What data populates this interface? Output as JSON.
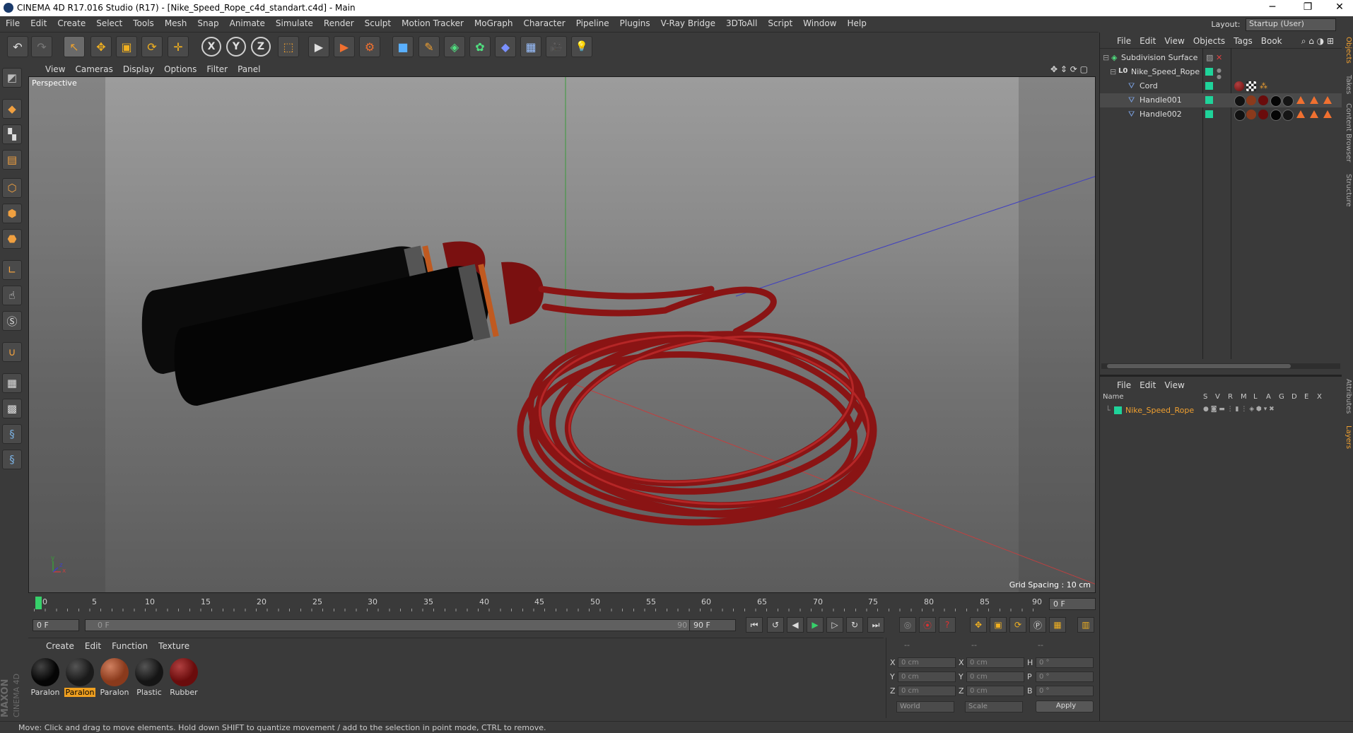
{
  "window": {
    "title": "CINEMA 4D R17.016 Studio (R17) - [Nike_Speed_Rope_c4d_standart.c4d] - Main",
    "minimize": "─",
    "restore": "❐",
    "close": "✕"
  },
  "menu": [
    "File",
    "Edit",
    "Create",
    "Select",
    "Tools",
    "Mesh",
    "Snap",
    "Animate",
    "Simulate",
    "Render",
    "Sculpt",
    "Motion Tracker",
    "MoGraph",
    "Character",
    "Pipeline",
    "Plugins",
    "V-Ray Bridge",
    "3DToAll",
    "Script",
    "Window",
    "Help"
  ],
  "layout": {
    "label": "Layout:",
    "value": "Startup (User)"
  },
  "toolbar": {
    "undo": "↶",
    "redo": "↷",
    "select": "↖",
    "move": "✥",
    "scale": "▣",
    "rotate": "⟳",
    "live": "✛",
    "x": "X",
    "y": "Y",
    "z": "Z",
    "coord": "⬚",
    "render_view": "▶",
    "render_pic": "▶",
    "render_settings": "⚙",
    "cube": "■",
    "pen": "✎",
    "subdiv": "◈",
    "array": "✿",
    "deform": "◆",
    "floor": "▦",
    "camera": "🎥",
    "light": "💡"
  },
  "viewport": {
    "menu": [
      "View",
      "Cameras",
      "Display",
      "Options",
      "Filter",
      "Panel"
    ],
    "label": "Perspective",
    "grid_spacing": "Grid Spacing : 10 cm",
    "axis_y": "y",
    "axis_x": "x",
    "axis_z": "z"
  },
  "timeline": {
    "ticks": [
      "0",
      "5",
      "10",
      "15",
      "20",
      "25",
      "30",
      "35",
      "40",
      "45",
      "50",
      "55",
      "60",
      "65",
      "70",
      "75",
      "80",
      "85",
      "90"
    ],
    "current_frame": "0 F",
    "start_frame": "0 F",
    "range_start": "0 F",
    "range_end": "90 F",
    "end_frame": "90 F"
  },
  "materials": {
    "menu": [
      "Create",
      "Edit",
      "Function",
      "Texture"
    ],
    "items": [
      {
        "name": "Paralon",
        "color": "#050505",
        "selected": false
      },
      {
        "name": "Paralon",
        "color": "#1a1a1a",
        "selected": true
      },
      {
        "name": "Paralon",
        "color": "#8a3a1c",
        "selected": false
      },
      {
        "name": "Plastic",
        "color": "#151515",
        "selected": false
      },
      {
        "name": "Rubber",
        "color": "#6a0c0c",
        "selected": false
      }
    ]
  },
  "coords": {
    "header": [
      "--",
      "--",
      "--"
    ],
    "rows": [
      {
        "a": "X",
        "av": "0 cm",
        "b": "X",
        "bv": "0 cm",
        "c": "H",
        "cv": "0 °"
      },
      {
        "a": "Y",
        "av": "0 cm",
        "b": "Y",
        "bv": "0 cm",
        "c": "P",
        "cv": "0 °"
      },
      {
        "a": "Z",
        "av": "0 cm",
        "b": "Z",
        "bv": "0 cm",
        "c": "B",
        "cv": "0 °"
      }
    ],
    "world": "World",
    "scale": "Scale",
    "apply": "Apply"
  },
  "objects": {
    "menu": [
      "File",
      "Edit",
      "View",
      "Objects",
      "Tags",
      "Book"
    ],
    "items": [
      {
        "name": "Subdivision Surface",
        "indent": 0
      },
      {
        "name": "Nike_Speed_Rope",
        "indent": 1
      },
      {
        "name": "Cord",
        "indent": 2
      },
      {
        "name": "Handle001",
        "indent": 2
      },
      {
        "name": "Handle002",
        "indent": 2
      }
    ]
  },
  "layers": {
    "menu": [
      "File",
      "Edit",
      "View"
    ],
    "columns": [
      "Name",
      "S",
      "V",
      "R",
      "M",
      "L",
      "A",
      "G",
      "D",
      "E",
      "X"
    ],
    "item": "Nike_Speed_Rope"
  },
  "sidetabs": [
    "Objects",
    "Takes",
    "Content Browser",
    "Structure",
    "Attributes",
    "Layers"
  ],
  "status": "Move: Click and drag to move elements. Hold down SHIFT to quantize movement / add to the selection in point mode, CTRL to remove.",
  "brand": {
    "line1": "MAXON",
    "line2": "CINEMA 4D"
  }
}
